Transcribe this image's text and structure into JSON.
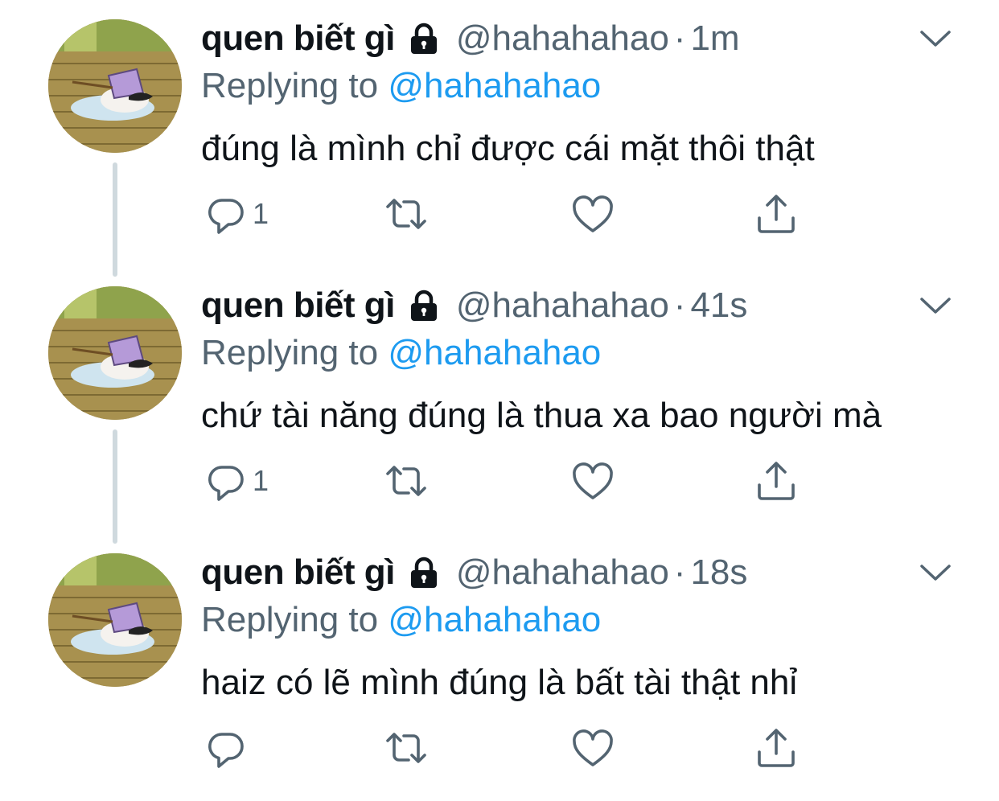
{
  "colors": {
    "text": "#0f1419",
    "secondary": "#536471",
    "link": "#1d9bf0",
    "thread_line": "#cfd9de"
  },
  "tweets": [
    {
      "display_name": "quen biết gì",
      "handle": "@hahahahao",
      "separator": "·",
      "time": "1m",
      "replying_prefix": "Replying to ",
      "replying_to": "@hahahahao",
      "text": "đúng là mình chỉ được cái mặt thôi thật",
      "reply_count": "1"
    },
    {
      "display_name": "quen biết gì",
      "handle": "@hahahahao",
      "separator": "·",
      "time": "41s",
      "replying_prefix": "Replying to ",
      "replying_to": "@hahahahao",
      "text": "chứ tài năng đúng là thua xa bao người mà",
      "reply_count": "1"
    },
    {
      "display_name": "quen biết gì",
      "handle": "@hahahahao",
      "separator": "·",
      "time": "18s",
      "replying_prefix": "Replying to ",
      "replying_to": "@hahahahao",
      "text": "haiz có lẽ mình đúng là bất tài thật nhỉ",
      "reply_count": ""
    }
  ],
  "icons": [
    "lock-icon",
    "chevron-down-icon",
    "reply-icon",
    "retweet-icon",
    "like-icon",
    "share-icon"
  ]
}
